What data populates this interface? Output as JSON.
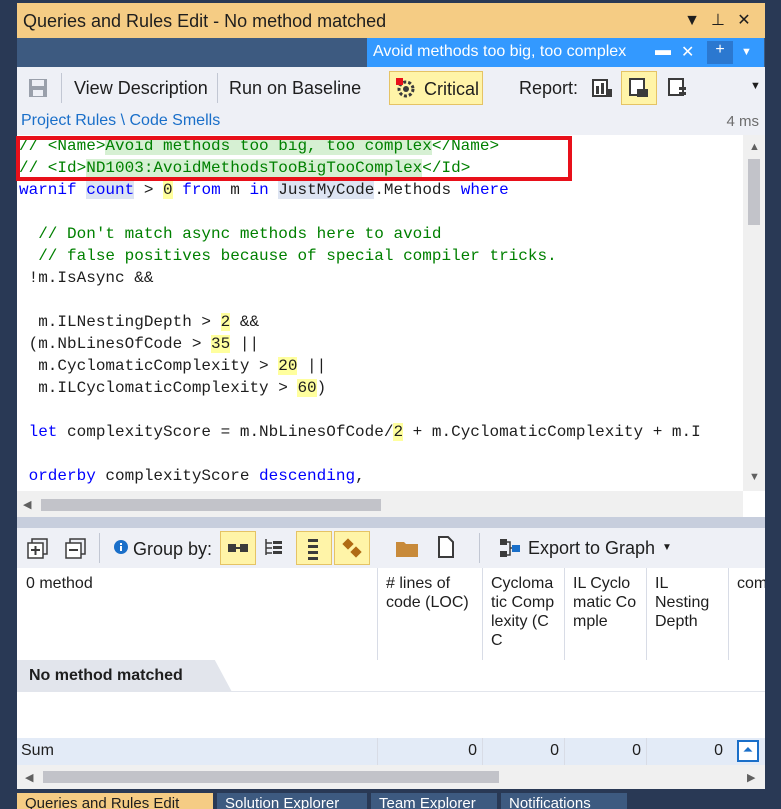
{
  "window": {
    "title": "Queries and Rules Edit  - No method matched",
    "doc_tab": "Avoid methods too big, too complex"
  },
  "toolbar": {
    "view_description": "View Description",
    "run_on_baseline": "Run on Baseline",
    "critical": "Critical",
    "report_label": "Report:"
  },
  "breadcrumb": {
    "path": "Project Rules \\ Code Smells",
    "elapsed": "4 ms"
  },
  "code": {
    "line1_pre": "// <Name>",
    "line1_hl": "Avoid methods too big, too complex",
    "line1_post": "</Name>",
    "line2_pre": "// <Id>",
    "line2_hl": "ND1003:AvoidMethodsTooBigTooComplex",
    "line2_post": "</Id>",
    "line3_kw1": "warnif",
    "line3_count": "count",
    "line3_gt": " > ",
    "line3_zero": "0",
    "line3_sp": " ",
    "line3_from": "from",
    "line3_m": " m ",
    "line3_in": "in",
    "line3_sp2": " ",
    "line3_jmc": "JustMyCode",
    "line3_methods": ".Methods ",
    "line3_where": "where",
    "line5": "  // Don't match async methods here to avoid",
    "line6": "  // false positives because of special compiler tricks.",
    "line7": " !m.IsAsync &&",
    "line9_a": "  m.ILNestingDepth > ",
    "line9_n": "2",
    "line9_b": " &&",
    "line10_a": " (m.NbLinesOfCode > ",
    "line10_n": "35",
    "line10_b": " ||",
    "line11_a": "  m.CyclomaticComplexity > ",
    "line11_n": "20",
    "line11_b": " ||",
    "line12_a": "  m.ILCyclomaticComplexity > ",
    "line12_n": "60",
    "line12_b": ")",
    "line14_kw": " let",
    "line14_a": " complexityScore = m.NbLinesOfCode/",
    "line14_n": "2",
    "line14_b": " + m.CyclomaticComplexity + m.I",
    "line16_kw": " orderby",
    "line16_a": " complexityScore ",
    "line16_kw2": "descending",
    "line16_b": ","
  },
  "results_toolbar": {
    "group_by": "Group by:",
    "export": "Export to Graph"
  },
  "grid": {
    "columns": [
      "0 method",
      "# lines of code (LOC)",
      "Cyclomatic Complexity (CC",
      "IL Cyclomatic Comple",
      "IL Nesting Depth",
      "com"
    ],
    "no_match": "No method matched",
    "sum_label": "Sum",
    "sum_values": [
      "0",
      "0",
      "0",
      "0"
    ]
  },
  "bottom_tabs": [
    "Queries and Rules Edit",
    "Solution Explorer",
    "Team Explorer",
    "Notifications"
  ],
  "colors": {
    "title_bar": "#f5cc84",
    "doc_tab": "#3399ff",
    "chrome_bg": "#293955",
    "highlight": "#fff4a8",
    "red_box": "#e8101a"
  }
}
